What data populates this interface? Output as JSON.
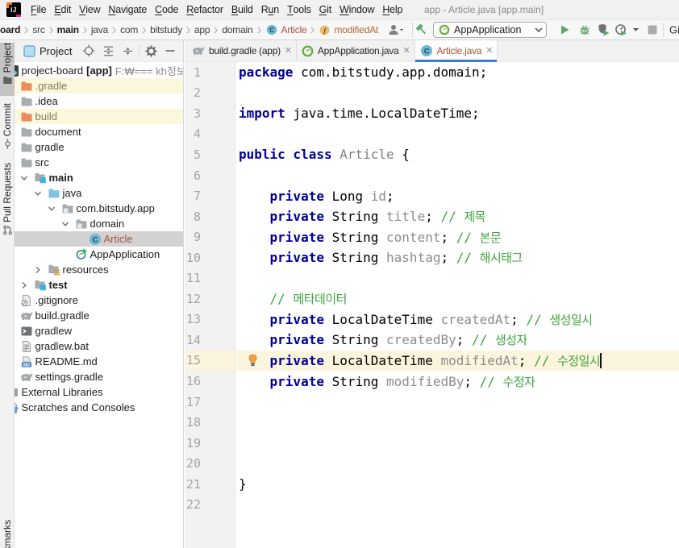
{
  "window": {
    "title": "app - Article.java [app.main]",
    "logo_monogram": "IJ"
  },
  "colors": {
    "accent-blue": "#3D7CD0",
    "keyword": "#000099",
    "comment-green": "#3CA43C",
    "field-gray": "#8C8C8C",
    "unversioned-brown": "#A4553C",
    "ignored-olive": "#7E7E52",
    "run-green": "#59A869",
    "caret-row": "#FCF5DE"
  },
  "menu": {
    "items": [
      {
        "label": "File",
        "mnemonic": "F"
      },
      {
        "label": "Edit",
        "mnemonic": "E"
      },
      {
        "label": "View",
        "mnemonic": "V"
      },
      {
        "label": "Navigate",
        "mnemonic": "N"
      },
      {
        "label": "Code",
        "mnemonic": "C"
      },
      {
        "label": "Refactor",
        "mnemonic": "R"
      },
      {
        "label": "Build",
        "mnemonic": "B"
      },
      {
        "label": "Run",
        "mnemonic": "u"
      },
      {
        "label": "Tools",
        "mnemonic": "T"
      },
      {
        "label": "Git",
        "mnemonic": "G"
      },
      {
        "label": "Window",
        "mnemonic": "W"
      },
      {
        "label": "Help",
        "mnemonic": "H"
      }
    ]
  },
  "navbar": {
    "crumbs": [
      {
        "label": "oard",
        "bold": true
      },
      {
        "label": "src"
      },
      {
        "label": "main",
        "bold": true
      },
      {
        "label": "java"
      },
      {
        "label": "com"
      },
      {
        "label": "bitstudy"
      },
      {
        "label": "app"
      },
      {
        "label": "domain"
      },
      {
        "label": "Article",
        "icon": "class",
        "color": "#A4553C"
      },
      {
        "label": "modifiedAt",
        "icon": "field",
        "color": "#B06A28"
      }
    ],
    "run_config": "AppApplication",
    "git_label": "Gi"
  },
  "stripe": {
    "top": [
      {
        "label": "Project",
        "icon": "folder-tool",
        "active": true
      },
      {
        "label": "Commit",
        "icon": "commit-tool"
      },
      {
        "label": "Pull Requests",
        "icon": "pr-tool"
      }
    ],
    "bottom": [
      {
        "label": "kmarks"
      }
    ]
  },
  "project_panel": {
    "title": "Project",
    "tree": [
      {
        "label": "project-board",
        "depth": 0,
        "icon": "project-root",
        "extras": [
          {
            "text": "[app]",
            "bold": true
          },
          {
            "text": "F:₩=== kh정보교육",
            "class": "tpath"
          }
        ]
      },
      {
        "label": ".gradle",
        "depth": 1,
        "icon": "folder-orange",
        "row_bg": "ylw",
        "class": "olive"
      },
      {
        "label": ".idea",
        "depth": 1,
        "icon": "folder"
      },
      {
        "label": "build",
        "depth": 1,
        "icon": "folder-orange",
        "row_bg": "ylw",
        "class": "olive"
      },
      {
        "label": "document",
        "depth": 1,
        "icon": "folder"
      },
      {
        "label": "gradle",
        "depth": 1,
        "icon": "folder"
      },
      {
        "label": "src",
        "depth": 1,
        "icon": "folder"
      },
      {
        "label": "main",
        "depth": 2,
        "icon": "folder-src",
        "chevron": "expanded",
        "bold": true
      },
      {
        "label": "java",
        "depth": 3,
        "icon": "folder-blue",
        "chevron": "expanded"
      },
      {
        "label": "com.bitstudy.app",
        "depth": 4,
        "icon": "package",
        "chevron": "expanded"
      },
      {
        "label": "domain",
        "depth": 5,
        "icon": "package",
        "chevron": "expanded"
      },
      {
        "label": "Article",
        "depth": 6,
        "icon": "class",
        "selected": true,
        "class": "brown"
      },
      {
        "label": "AppApplication",
        "depth": 5,
        "icon": "spring-run"
      },
      {
        "label": "resources",
        "depth": 3,
        "icon": "folder-resources",
        "chevron": "collapsed"
      },
      {
        "label": "test",
        "depth": 2,
        "icon": "folder-src",
        "chevron": "collapsed",
        "bold": true
      },
      {
        "label": ".gitignore",
        "depth": 1,
        "icon": "file-ignore"
      },
      {
        "label": "build.gradle",
        "depth": 1,
        "icon": "gradle"
      },
      {
        "label": "gradlew",
        "depth": 1,
        "icon": "console"
      },
      {
        "label": "gradlew.bat",
        "depth": 1,
        "icon": "file-text"
      },
      {
        "label": "README.md",
        "depth": 1,
        "icon": "markdown"
      },
      {
        "label": "settings.gradle",
        "depth": 1,
        "icon": "gradle"
      },
      {
        "label": "External Libraries",
        "depth": 0,
        "icon": "clip-none"
      },
      {
        "label": "Scratches and Consoles",
        "depth": 0,
        "icon": "scratches"
      }
    ]
  },
  "tabs": [
    {
      "label": "build.gradle (app)",
      "icon": "gradle"
    },
    {
      "label": "AppApplication.java",
      "icon": "spring"
    },
    {
      "label": "Article.java",
      "icon": "class",
      "selected": true
    }
  ],
  "editor": {
    "caret_line": 15,
    "lines": [
      {
        "n": 1,
        "seg": [
          [
            "kw",
            "package"
          ],
          [
            "pl",
            " com.bitstudy.app.domain;"
          ]
        ]
      },
      {
        "n": 2,
        "seg": []
      },
      {
        "n": 3,
        "seg": [
          [
            "kw",
            "import"
          ],
          [
            "pl",
            " java.time.LocalDateTime;"
          ]
        ]
      },
      {
        "n": 4,
        "seg": []
      },
      {
        "n": 5,
        "seg": [
          [
            "kw",
            "public class"
          ],
          [
            "pl",
            " "
          ],
          [
            "cls",
            "Article"
          ],
          [
            "pl",
            " {"
          ]
        ]
      },
      {
        "n": 6,
        "seg": []
      },
      {
        "n": 7,
        "seg": [
          [
            "pl",
            "    "
          ],
          [
            "kw",
            "private"
          ],
          [
            "pl",
            " Long "
          ],
          [
            "fld",
            "id"
          ],
          [
            "pl",
            ";"
          ]
        ]
      },
      {
        "n": 8,
        "seg": [
          [
            "pl",
            "    "
          ],
          [
            "kw",
            "private"
          ],
          [
            "pl",
            " String "
          ],
          [
            "fld",
            "title"
          ],
          [
            "pl",
            "; "
          ],
          [
            "cmt",
            "// 제목"
          ]
        ]
      },
      {
        "n": 9,
        "seg": [
          [
            "pl",
            "    "
          ],
          [
            "kw",
            "private"
          ],
          [
            "pl",
            " String "
          ],
          [
            "fld",
            "content"
          ],
          [
            "pl",
            "; "
          ],
          [
            "cmt",
            "// 본문"
          ]
        ]
      },
      {
        "n": 10,
        "seg": [
          [
            "pl",
            "    "
          ],
          [
            "kw",
            "private"
          ],
          [
            "pl",
            " String "
          ],
          [
            "fld",
            "hashtag"
          ],
          [
            "pl",
            "; "
          ],
          [
            "cmt",
            "// 해시태그"
          ]
        ]
      },
      {
        "n": 11,
        "seg": []
      },
      {
        "n": 12,
        "seg": [
          [
            "pl",
            "    "
          ],
          [
            "cmt",
            "// 메타데이터"
          ]
        ]
      },
      {
        "n": 13,
        "seg": [
          [
            "pl",
            "    "
          ],
          [
            "kw",
            "private"
          ],
          [
            "pl",
            " LocalDateTime "
          ],
          [
            "fld",
            "createdAt"
          ],
          [
            "pl",
            "; "
          ],
          [
            "cmt",
            "// 생성일시"
          ]
        ]
      },
      {
        "n": 14,
        "seg": [
          [
            "pl",
            "    "
          ],
          [
            "kw",
            "private"
          ],
          [
            "pl",
            " String "
          ],
          [
            "fld",
            "createdBy"
          ],
          [
            "pl",
            "; "
          ],
          [
            "cmt",
            "// 생성자"
          ]
        ]
      },
      {
        "n": 15,
        "seg": [
          [
            "pl",
            "    "
          ],
          [
            "kw",
            "private"
          ],
          [
            "pl",
            " LocalDateTime "
          ],
          [
            "fld",
            "modifiedAt"
          ],
          [
            "pl",
            "; "
          ],
          [
            "cmt",
            "// 수정일시"
          ]
        ]
      },
      {
        "n": 16,
        "seg": [
          [
            "pl",
            "    "
          ],
          [
            "kw",
            "private"
          ],
          [
            "pl",
            " String "
          ],
          [
            "fld",
            "modifiedBy"
          ],
          [
            "pl",
            "; "
          ],
          [
            "cmt",
            "// 수정자"
          ]
        ]
      },
      {
        "n": 17,
        "seg": []
      },
      {
        "n": 18,
        "seg": []
      },
      {
        "n": 19,
        "seg": []
      },
      {
        "n": 20,
        "seg": []
      },
      {
        "n": 21,
        "seg": [
          [
            "pl",
            "}"
          ]
        ]
      },
      {
        "n": 22,
        "seg": []
      }
    ]
  }
}
